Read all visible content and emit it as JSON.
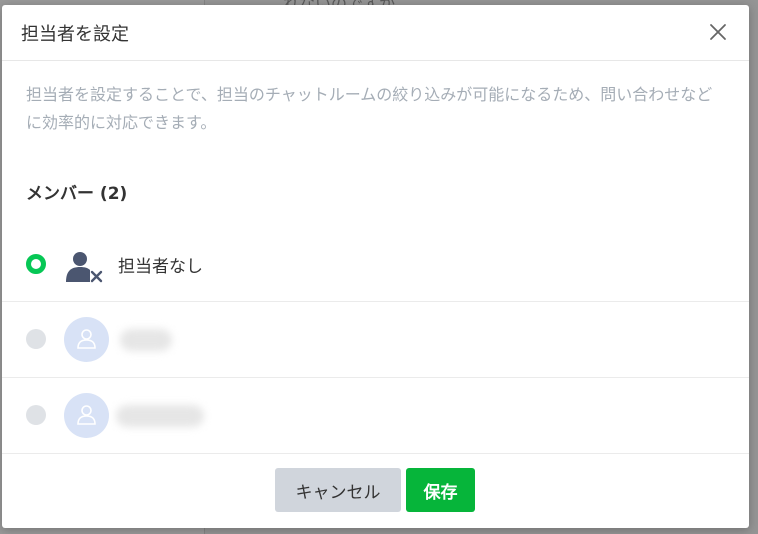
{
  "background": {
    "partial_text": "れないのですか。"
  },
  "modal": {
    "title": "担当者を設定",
    "description": "担当者を設定することで、担当のチャットルームの絞り込みが可能になるため、問い合わせなどに効率的に対応できます。",
    "members_heading": "メンバー (2)",
    "options": [
      {
        "label": "担当者なし",
        "selected": true,
        "icon": "user-remove-icon"
      },
      {
        "label": "",
        "selected": false,
        "icon": "avatar-placeholder-icon"
      },
      {
        "label": "",
        "selected": false,
        "icon": "avatar-placeholder-icon"
      }
    ],
    "cancel_label": "キャンセル",
    "save_label": "保存"
  },
  "colors": {
    "accent_green": "#06c755",
    "save_button": "#06b53a",
    "cancel_button": "#d0d5dc",
    "avatar_bg": "#d8e2f6",
    "description_text": "#a5adb6"
  }
}
